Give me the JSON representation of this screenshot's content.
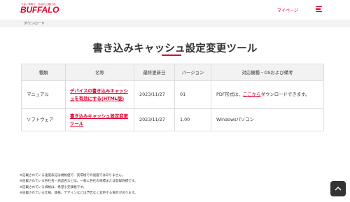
{
  "header": {
    "tagline": "つなぐ技術で、あなたに届ける。",
    "logo": "BUFFALO",
    "mypage": "マイページ",
    "menu_icon": "hamburger-menu-icon"
  },
  "breadcrumb": {
    "current": "ダウンロード"
  },
  "page": {
    "title": "書き込みキャッシュ設定変更ツール"
  },
  "table": {
    "headers": [
      "種類",
      "名称",
      "最終更新日",
      "バージョン",
      "対応機種・OSおよび備考"
    ],
    "rows": [
      {
        "type": "マニュアル",
        "name": "デバイスの書き込みキャッシュを有効にする(HTML版)",
        "updated": "2023/11/27",
        "version": "01",
        "notes_prefix": "PDF形式は、",
        "notes_link": "ここから",
        "notes_suffix": "ダウンロードできます。"
      },
      {
        "type": "ソフトウェア",
        "name": "書き込みキャッシュ設定変更ツール",
        "updated": "2023/11/27",
        "version": "1.00",
        "notes": "Windowsパソコン"
      }
    ]
  },
  "footnotes": [
    "※記載されている速度表記は規格値で、実環境での速度ではありません。",
    "※記載されている各社名・商品名などは、一般に各社の商標または登録商標です。",
    "※記載されている価格は、希望小売価格です。",
    "※記載されている仕様、価格、デザインなどは予告なく変更する場合があります。"
  ],
  "page_top": {
    "icon": "chevron-up-icon"
  },
  "colors": {
    "brand": "#d9002b",
    "text": "#333333",
    "header_bg": "#f2f2f2"
  }
}
